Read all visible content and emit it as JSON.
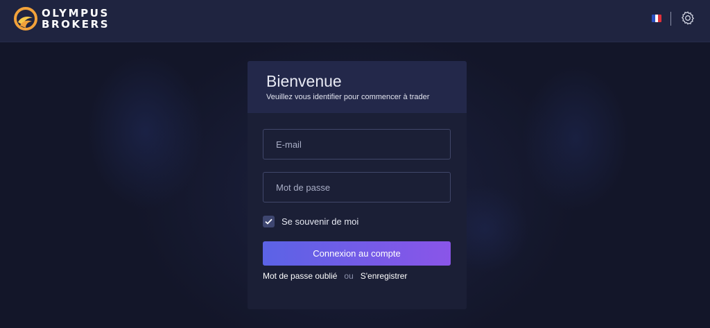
{
  "brand": {
    "line1": "OLYMPUS",
    "line2": "BROKERS",
    "colors": {
      "orange": "#f2a23a",
      "yellow": "#f7c94a"
    }
  },
  "header": {
    "language_flag": "french-flag-icon",
    "settings_icon": "gear-icon"
  },
  "login": {
    "title": "Bienvenue",
    "subtitle": "Veuillez vous identifier pour commencer à trader",
    "email": {
      "value": "",
      "placeholder": "E-mail"
    },
    "password": {
      "value": "",
      "placeholder": "Mot de passe"
    },
    "remember": {
      "label": "Se souvenir de moi",
      "checked": true
    },
    "submit_label": "Connexion au compte",
    "forgot_label": "Mot de passe oublié",
    "separator": "ou",
    "register_label": "S'enregistrer"
  },
  "colors": {
    "accent_start": "#5b63e6",
    "accent_end": "#8a55e8",
    "background": "#161a2e"
  }
}
